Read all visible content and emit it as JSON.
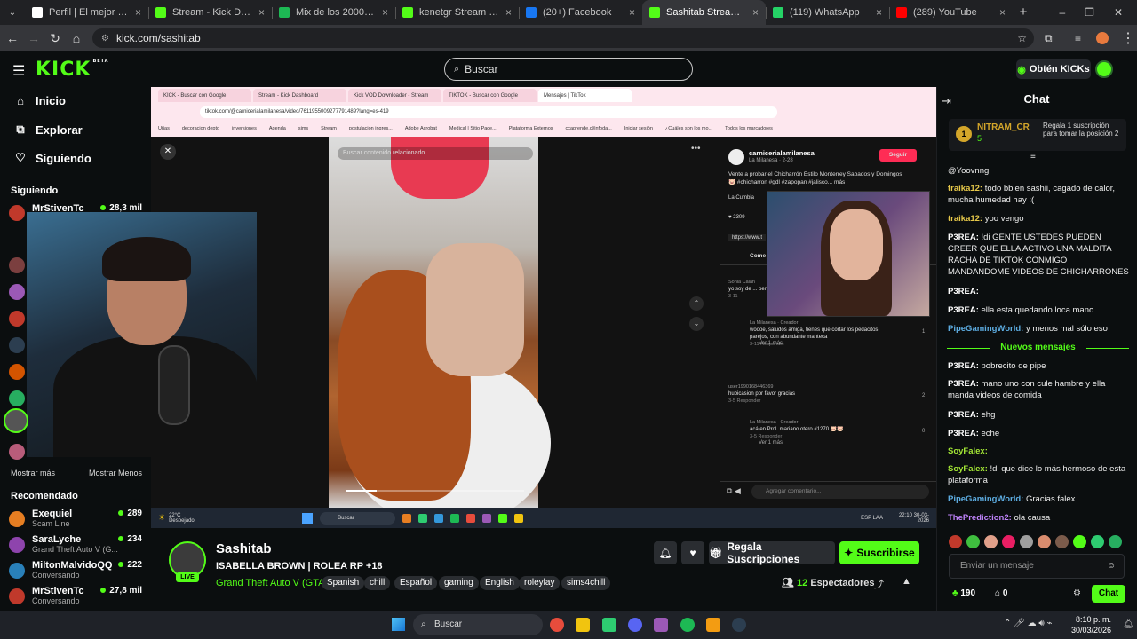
{
  "browser": {
    "tabs": [
      {
        "title": "Perfil | El mejor software p",
        "fav": "#fff",
        "active": false
      },
      {
        "title": "Stream - Kick Dashboard",
        "fav": "#53fc18",
        "active": false
      },
      {
        "title": "Mix de los 2000 | Spotify",
        "fav": "#1db954",
        "active": false
      },
      {
        "title": "kenetgr Stream - Watch L",
        "fav": "#53fc18",
        "active": false
      },
      {
        "title": "(20+) Facebook",
        "fav": "#1877f2",
        "active": false
      },
      {
        "title": "Sashitab Stream - Wa",
        "fav": "#53fc18",
        "active": true
      },
      {
        "title": "(119) WhatsApp",
        "fav": "#25d366",
        "active": false
      },
      {
        "title": "(289) YouTube",
        "fav": "#ff0000",
        "active": false
      }
    ],
    "url": "kick.com/sashitab",
    "new_tab": "+"
  },
  "header": {
    "logo": "KICK",
    "beta": "BETA",
    "search_placeholder": "Buscar",
    "kicks_button": "Obtén KICKs"
  },
  "sidebar": {
    "nav": [
      {
        "label": "Inicio",
        "icon": "home-icon"
      },
      {
        "label": "Explorar",
        "icon": "explore-icon"
      },
      {
        "label": "Siguiendo",
        "icon": "heart-icon"
      }
    ],
    "following_title": "Siguiendo",
    "following": [
      {
        "name": "MrStivenTc",
        "viewers": "28,3 mil",
        "color": "#c0392b"
      }
    ],
    "show_more": "Mostrar más",
    "show_less": "Mostrar Menos",
    "recommended_title": "Recomendado",
    "recommended": [
      {
        "name": "Exequiel",
        "sub": "Scam Line",
        "viewers": "289",
        "color": "#e67e22"
      },
      {
        "name": "SaraLyche",
        "sub": "Grand Theft Auto V (G...",
        "viewers": "234",
        "color": "#8e44ad"
      },
      {
        "name": "MiltonMalvidoQQ",
        "sub": "Conversando",
        "viewers": "222",
        "color": "#2980b9"
      },
      {
        "name": "MrStivenTc",
        "sub": "Conversando",
        "viewers": "27,8 mil",
        "color": "#c0392b"
      }
    ]
  },
  "video": {
    "inner_tabs": [
      "KICK - Buscar con Google",
      "Stream - Kick Dashboard",
      "Kick VOD Downloader - Stream",
      "TIKTOK - Buscar con Google",
      "Mensajes | TikTok"
    ],
    "inner_url": "tiktok.com/@carnicerialamilanesa/video/7611955009277791489?lang=es-419",
    "bookmarks": [
      "Uñas",
      "decoracion depto",
      "inversiones",
      "Agenda",
      "sims",
      "Stream",
      "postulacion ingres...",
      "Adobe Acrobat",
      "Medical | Sitio Pace...",
      "Plataforma Externos",
      "ccaprende.cl/infoda...",
      "Iniciar sesión",
      "¿Cuáles son los mo...",
      "Todos los marcadores"
    ],
    "search_related": "Buscar contenido relacionado",
    "tiktok_account": "carnicerialamilanesa",
    "tiktok_sub": "La Milanesa · 2-28",
    "follow_btn": "Seguir",
    "caption": "Vente a probar el Chicharrón Estilo Monterrey Sabados y Domingos 🐷 #chicharron #gdl #zapopan #jalisco... más",
    "music": "La Cumbia",
    "likes": "2309",
    "link": "https://www.t",
    "comments_tab": "Come",
    "comments": [
      {
        "user": "Sonia Calan",
        "text": "yo soy de ... pero nada",
        "meta": "3-11",
        "likes": ""
      },
      {
        "user": "La Milanesa · Creador",
        "text": "woooe, saludos amiga, tienes que cortar los pedacitos parejos, con abundante manteca",
        "meta": "3-11  Responder",
        "likes": "1"
      },
      {
        "user": "user1990168446369",
        "text": "hubicasion por favor gracias",
        "meta": "3-5  Responder",
        "likes": "2"
      },
      {
        "user": "La Milanesa · Creador",
        "text": "acá en Prol. mariano otero #1270 🐷🐷",
        "meta": "3-5  Responder",
        "likes": "0"
      }
    ],
    "view_more": "Ver 1 más",
    "comment_placeholder": "Agregar comentario...",
    "weather": "22°C Despejado",
    "inner_search": "Buscar",
    "inner_clock": "22:10 30-03-2026",
    "inner_lang": "ESP LAA"
  },
  "stream": {
    "name": "Sashitab",
    "title": "ISABELLA BROWN | ROLEA RP +18",
    "category": "Grand Theft Auto V (GTA)",
    "tags": [
      "Spanish",
      "chill",
      "Español",
      "gaming",
      "English",
      "roleylay",
      "sims4chill"
    ],
    "live": "LIVE",
    "gift_button": "Regala Suscripciones",
    "subscribe_button": "Suscribirse",
    "viewers_count": "12",
    "viewers_label": "Espectadores"
  },
  "chat": {
    "title": "Chat",
    "pinned": {
      "user": "NITRAM_CR",
      "count": "5",
      "rank": "1",
      "text": "Regala 1 suscripción para tomar la posición 2"
    },
    "messages": [
      {
        "user": "",
        "text": "@Yoovnng",
        "color": "#fff"
      },
      {
        "user": "traika12",
        "text": "todo bbien sashii, cagado de calor, mucha humedad hay :(",
        "color": "#e6c84a"
      },
      {
        "user": "traika12",
        "text": "yoo vengo",
        "color": "#e6c84a"
      },
      {
        "user": "P3REA",
        "text": "!di GENTE USTEDES PUEDEN CREER QUE ELLA ACTIVO UNA MALDITA RACHA DE TIKTOK CONMIGO MANDANDOME VIDEOS DE CHICHARRONES",
        "color": "#fff"
      },
      {
        "user": "P3REA",
        "text": "",
        "color": "#fff"
      },
      {
        "user": "P3REA",
        "text": "ella esta quedando loca mano",
        "color": "#fff"
      },
      {
        "user": "PipeGamingWorld",
        "text": "y menos mal sólo eso",
        "color": "#5dade2"
      },
      {
        "user": "P3REA",
        "text": "pobrecito de pipe",
        "color": "#fff"
      },
      {
        "user": "P3REA",
        "text": "mano uno con cule hambre y ella manda videos de comida",
        "color": "#fff"
      },
      {
        "user": "P3REA",
        "text": "ehg",
        "color": "#fff"
      },
      {
        "user": "P3REA",
        "text": "eche",
        "color": "#fff"
      },
      {
        "user": "SoyFalex",
        "text": "",
        "color": "#a3e635"
      },
      {
        "user": "SoyFalex",
        "text": "!di que dice lo más hermoso de esta plataforma",
        "color": "#a3e635"
      },
      {
        "user": "PipeGamingWorld",
        "text": "Gracias falex",
        "color": "#5dade2"
      },
      {
        "user": "ThePrediction2",
        "text": "ola causa",
        "color": "#c084fc"
      }
    ],
    "new_messages": "Nuevos mensajes",
    "input_placeholder": "Enviar un mensaje",
    "points": "190",
    "gifts": "0",
    "send_button": "Chat"
  },
  "taskbar": {
    "search": "Buscar",
    "time": "8:10 p. m.",
    "date": "30/03/2026"
  }
}
